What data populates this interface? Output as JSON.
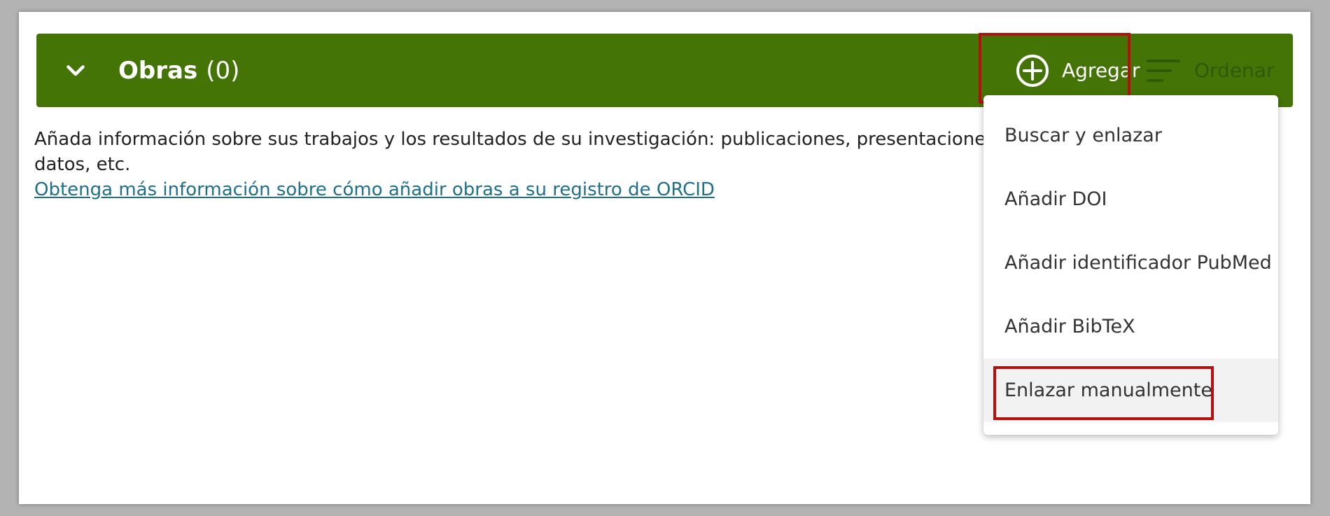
{
  "section": {
    "title": "Obras",
    "count": "(0)",
    "add_label": "Agregar",
    "sort_label": "Ordenar"
  },
  "description": {
    "line1": "Añada información sobre sus trabajos y los resultados de su investigación: publicaciones, presentaciones",
    "line2": "datos, etc.",
    "link": "Obtenga más información sobre cómo añadir obras a su registro de ORCID"
  },
  "menu": {
    "items": [
      {
        "label": "Buscar y enlazar"
      },
      {
        "label": "Añadir DOI"
      },
      {
        "label": "Añadir identificador PubMed"
      },
      {
        "label": "Añadir BibTeX"
      },
      {
        "label": "Enlazar manualmente"
      }
    ]
  },
  "colors": {
    "header_bg": "#447405",
    "highlight": "#b50f0f",
    "link": "#1f6f8b"
  },
  "icons": {
    "collapse": "chevron-down-icon",
    "add": "plus-circle-icon",
    "sort": "sort-lines-icon"
  }
}
